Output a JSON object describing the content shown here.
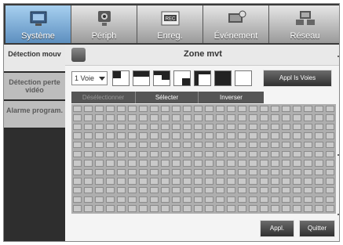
{
  "tabs": [
    {
      "label": "Système",
      "icon": "monitor-icon",
      "active": true
    },
    {
      "label": "Périph",
      "icon": "camera-icon",
      "active": false
    },
    {
      "label": "Enreg.",
      "icon": "rec-icon",
      "active": false
    },
    {
      "label": "Événement",
      "icon": "event-icon",
      "active": false
    },
    {
      "label": "Réseau",
      "icon": "network-icon",
      "active": false
    }
  ],
  "side_menu": [
    {
      "label": "Détection mouv",
      "active": true
    },
    {
      "label": "Détection perte vidéo",
      "active": false
    },
    {
      "label": "Alarme program.",
      "active": false
    }
  ],
  "panel": {
    "title": "Zone mvt",
    "channel_select": "1 Voie",
    "apply_channels": "Appl Is Voies",
    "grid_buttons": {
      "deselect": "Désélectionner",
      "select": "Sélecter",
      "invert": "Inverser"
    },
    "apply": "Appl.",
    "quit": "Quitter"
  },
  "colors": {
    "active_tab": "#7fb0dc",
    "button_dark": "#3a3a3a"
  }
}
